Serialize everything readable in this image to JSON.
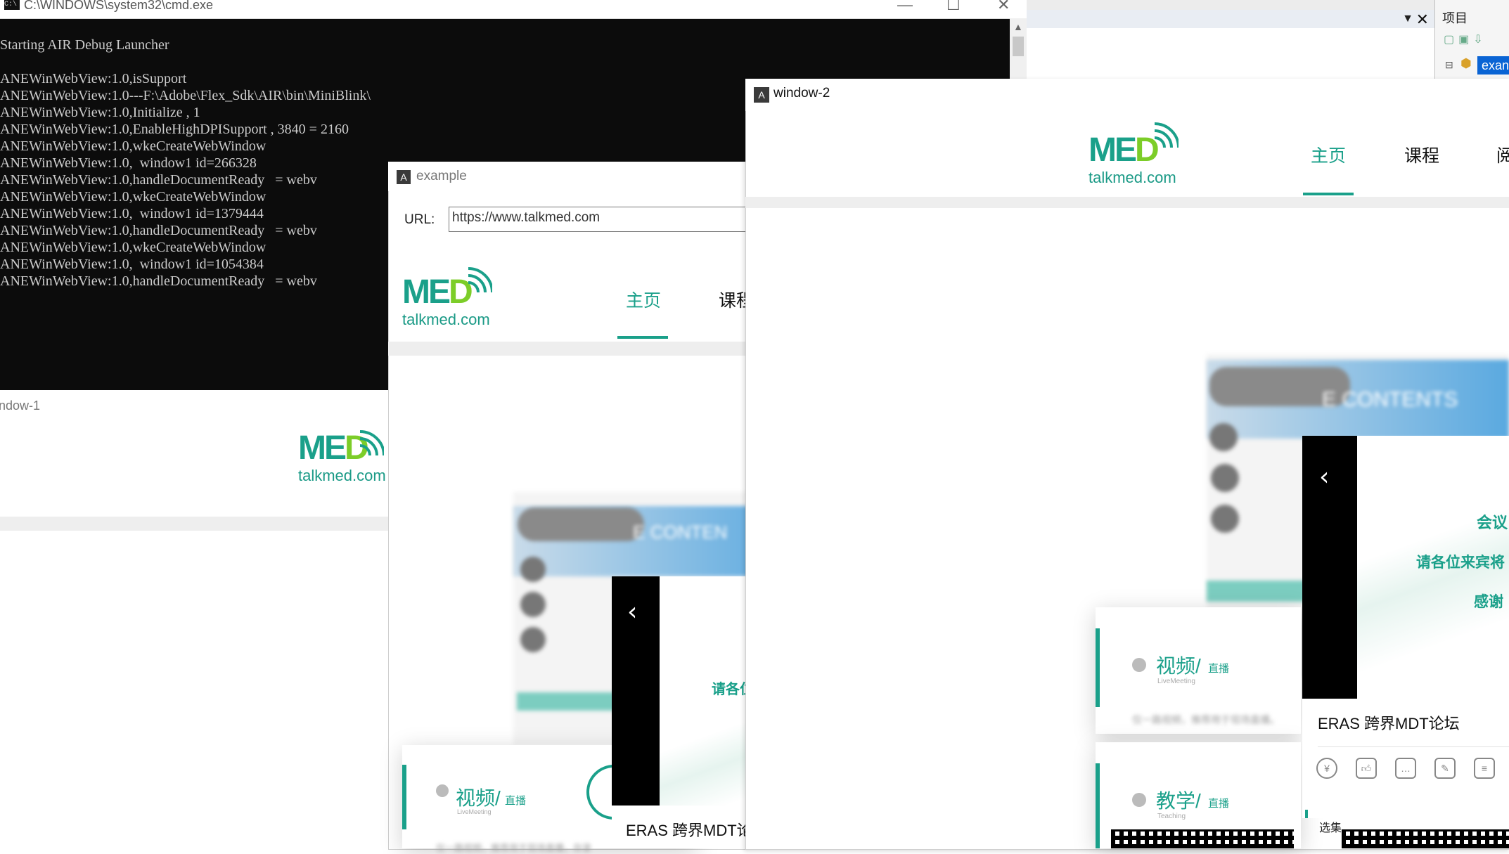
{
  "cmd": {
    "title": "C:\\WINDOWS\\system32\\cmd.exe",
    "lines": [
      "Starting AIR Debug Launcher",
      "",
      "ANEWinWebView:1.0,isSupport",
      "ANEWinWebView:1.0---F:\\Adobe\\Flex_Sdk\\AIR\\bin\\MiniBlink\\",
      "ANEWinWebView:1.0,Initialize , 1",
      "ANEWinWebView:1.0,EnableHighDPISupport , 3840 = 2160",
      "ANEWinWebView:1.0,wkeCreateWebWindow",
      "ANEWinWebView:1.0,  window1 id=266328",
      "ANEWinWebView:1.0,handleDocumentReady   = webv",
      "ANEWinWebView:1.0,wkeCreateWebWindow",
      "ANEWinWebView:1.0,  window1 id=1379444",
      "ANEWinWebView:1.0,handleDocumentReady   = webv",
      "ANEWinWebView:1.0,wkeCreateWebWindow",
      "ANEWinWebView:1.0,  window1 id=1054384",
      "ANEWinWebView:1.0,handleDocumentReady   = webv"
    ]
  },
  "ide": {
    "panel_title": "项目",
    "tree_item": "exan"
  },
  "window1": {
    "title": "ndow-1"
  },
  "logo": {
    "text": "MED",
    "domain": "talkmed.com"
  },
  "example": {
    "title": "example",
    "url_label": "URL:",
    "url_value": "https://www.talkmed.com",
    "nav": {
      "home": "主页",
      "course": "课程"
    },
    "banner_text": "E CONTEN",
    "video_title": "视频/",
    "video_live": "直播",
    "video_sub": "LiveMeeting",
    "video_desc": "仅一路视频，推荐用于现场直播，存录",
    "promo_partial": "请各位",
    "eras": "ERAS 跨界MDT论坛"
  },
  "window2": {
    "title": "window-2",
    "nav": {
      "home": "主页",
      "course": "课程",
      "read": "阅"
    },
    "banner_text": "E CONTENTS",
    "promo_line1": "会议",
    "promo_line2": "请各位来宾将",
    "promo_line3": "感谢",
    "video_title": "视频/",
    "video_live": "直播",
    "video_sub": "LiveMeeting",
    "video_desc": "仅一路视频，推荐用于现场直播。",
    "teach_title": "教学/",
    "teach_live": "直播",
    "teach_sub": "Teaching",
    "eras": "ERAS 跨界MDT论坛",
    "next_partial": "选集"
  },
  "colors": {
    "brand_teal": "#1aa08a",
    "brand_green": "#7ccd28",
    "console_bg": "#0c0c0c",
    "console_fg": "#cccccc"
  }
}
